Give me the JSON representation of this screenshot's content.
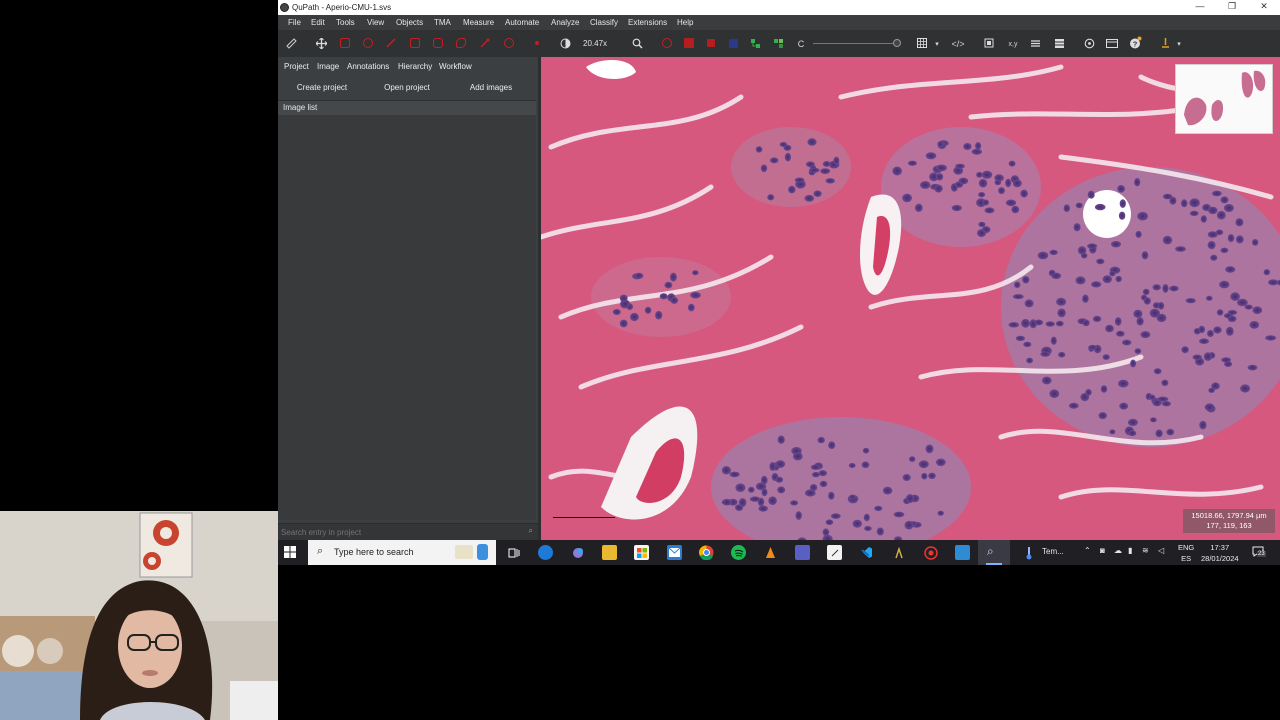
{
  "window": {
    "title": "QuPath - Aperio-CMU-1.svs",
    "controls": {
      "minimize": "—",
      "restore": "❐",
      "close": "✕"
    }
  },
  "menu": [
    "File",
    "Edit",
    "Tools",
    "View",
    "Objects",
    "TMA",
    "Measure",
    "Automate",
    "Analyze",
    "Classify",
    "Extensions",
    "Help"
  ],
  "toolbar": {
    "zoom": "20.47x",
    "counter_label": "C",
    "code_label": "</>",
    "xy_label": "x,y",
    "accent_red": "#d2262a",
    "accent_green": "#35b04a",
    "icons": [
      "ruler-icon",
      "move-icon",
      "rectangle-tool-icon",
      "ellipse-tool-icon",
      "line-tool-icon",
      "polygon-tool-icon",
      "polyline-tool-icon",
      "brush-tool-icon",
      "wand-tool-icon",
      "points-tool-icon",
      "brightness-contrast-icon",
      "zoom-to-fit-icon",
      "show-annotations-icon",
      "fill-annotations-icon",
      "show-names-icon",
      "show-tma-icon",
      "show-detections-icon",
      "show-pixel-classification-icon",
      "grid-icon",
      "script-icon",
      "measurement-table-icon",
      "help-icon",
      "log-icon"
    ]
  },
  "left_panel": {
    "tabs": [
      "Project",
      "Image",
      "Annotations",
      "Hierarchy",
      "Workflow"
    ],
    "buttons": {
      "create": "Create project",
      "open": "Open project",
      "add": "Add images"
    },
    "image_list_header": "Image list",
    "search_placeholder": "Search entry in project"
  },
  "viewer": {
    "coords_line1": "15018.66, 1797.94 µm",
    "coords_line2": "177, 119, 163"
  },
  "taskbar": {
    "search_text": "Type here to search",
    "running_label": "Tem...",
    "lang_line1": "ENG",
    "lang_line2": "ES",
    "time": "17:37",
    "date": "28/01/2024",
    "notification_count": "23"
  }
}
